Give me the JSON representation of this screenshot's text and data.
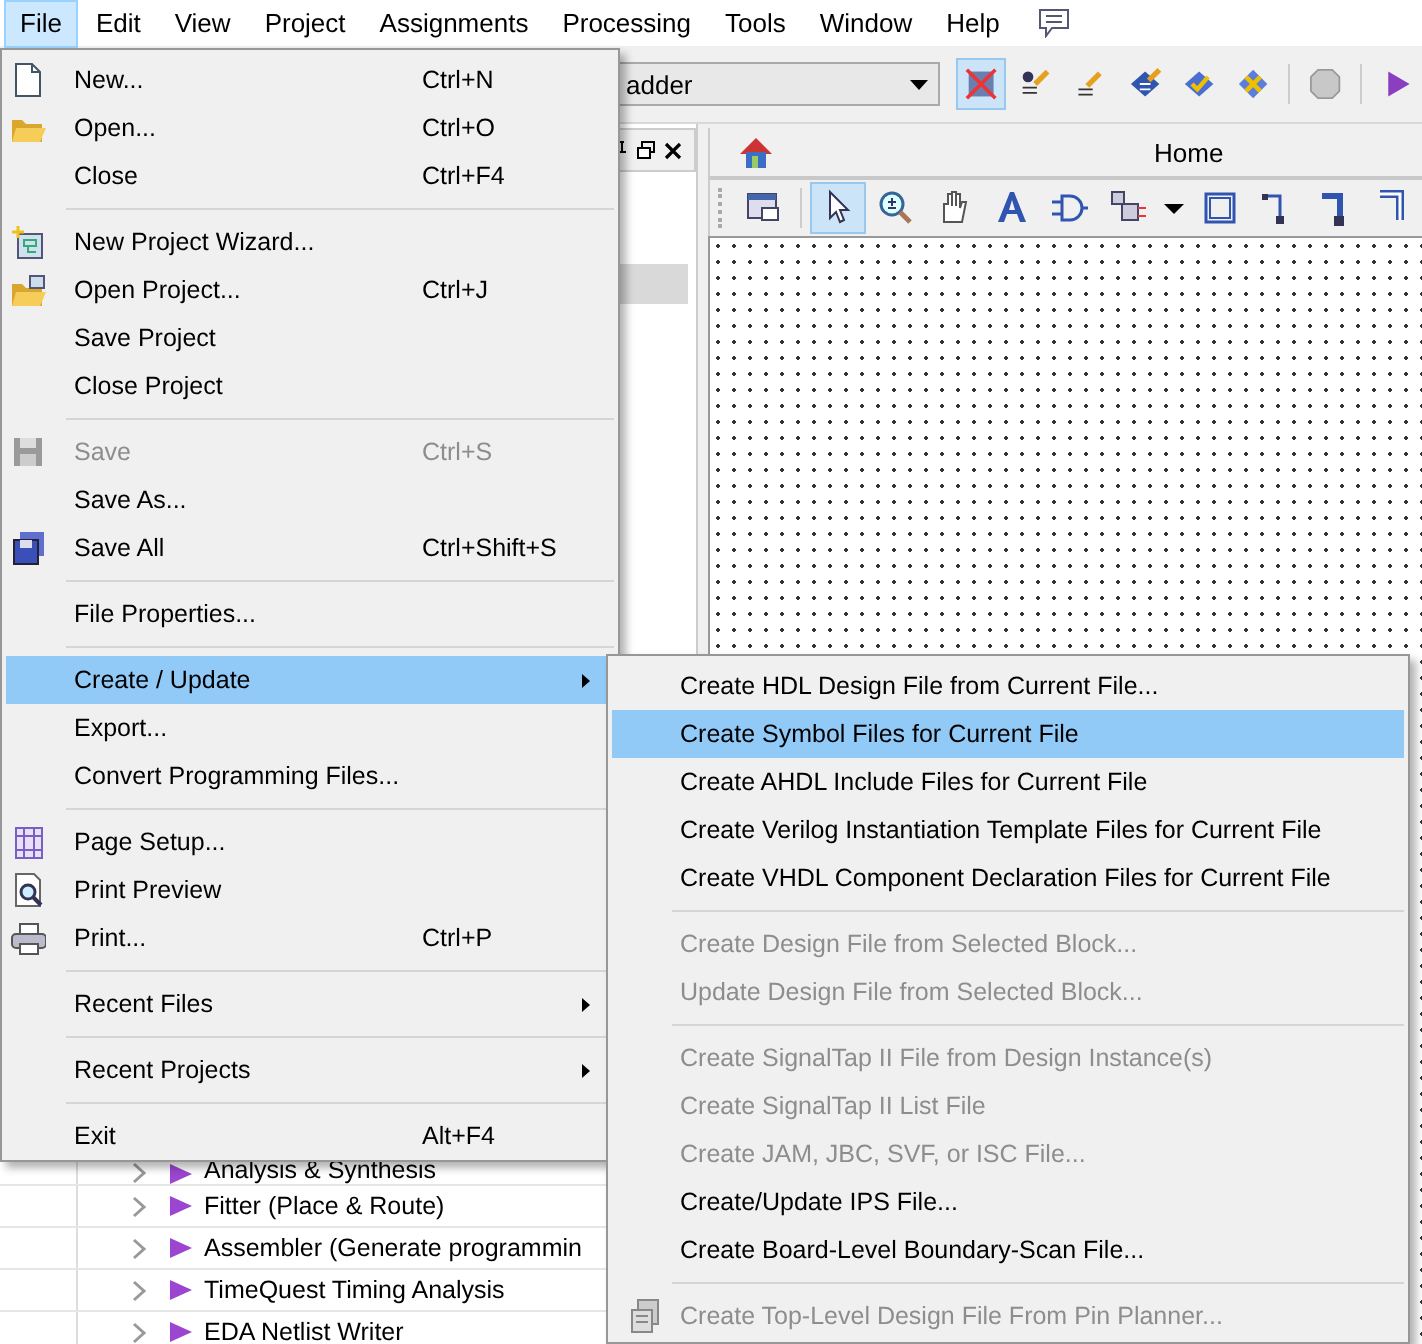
{
  "menu_bar": [
    {
      "label": "File",
      "selected": true
    },
    {
      "label": "Edit",
      "selected": false
    },
    {
      "label": "View",
      "selected": false
    },
    {
      "label": "Project",
      "selected": false
    },
    {
      "label": "Assignments",
      "selected": false
    },
    {
      "label": "Processing",
      "selected": false
    },
    {
      "label": "Tools",
      "selected": false
    },
    {
      "label": "Window",
      "selected": false
    },
    {
      "label": "Help",
      "selected": false
    }
  ],
  "toolbar": {
    "entity_dropdown": {
      "value": "adder"
    }
  },
  "home_tab": {
    "title": "Home"
  },
  "flow_tasks": [
    {
      "label": "Analysis & Synthesis"
    },
    {
      "label": "Fitter (Place & Route)"
    },
    {
      "label": "Assembler (Generate programmin"
    },
    {
      "label": "TimeQuest Timing Analysis"
    },
    {
      "label": "EDA Netlist Writer"
    }
  ],
  "file_menu": [
    {
      "kind": "item",
      "label": "New...",
      "shortcut": "Ctrl+N",
      "disabled": false,
      "selected": false,
      "submenu": false
    },
    {
      "kind": "item",
      "label": "Open...",
      "shortcut": "Ctrl+O",
      "disabled": false,
      "selected": false,
      "submenu": false
    },
    {
      "kind": "item",
      "label": "Close",
      "shortcut": "Ctrl+F4",
      "disabled": false,
      "selected": false,
      "submenu": false
    },
    {
      "kind": "separator"
    },
    {
      "kind": "item",
      "label": "New Project Wizard...",
      "disabled": false,
      "selected": false,
      "submenu": false
    },
    {
      "kind": "item",
      "label": "Open Project...",
      "shortcut": "Ctrl+J",
      "disabled": false,
      "selected": false,
      "submenu": false
    },
    {
      "kind": "item",
      "label": "Save Project",
      "disabled": false,
      "selected": false,
      "submenu": false
    },
    {
      "kind": "item",
      "label": "Close Project",
      "disabled": false,
      "selected": false,
      "submenu": false
    },
    {
      "kind": "separator"
    },
    {
      "kind": "item",
      "label": "Save",
      "shortcut": "Ctrl+S",
      "disabled": true,
      "selected": false,
      "submenu": false
    },
    {
      "kind": "item",
      "label": "Save As...",
      "disabled": false,
      "selected": false,
      "submenu": false
    },
    {
      "kind": "item",
      "label": "Save All",
      "shortcut": "Ctrl+Shift+S",
      "disabled": false,
      "selected": false,
      "submenu": false
    },
    {
      "kind": "separator"
    },
    {
      "kind": "item",
      "label": "File Properties...",
      "disabled": false,
      "selected": false,
      "submenu": false
    },
    {
      "kind": "separator"
    },
    {
      "kind": "item",
      "label": "Create / Update",
      "disabled": false,
      "selected": true,
      "submenu": true
    },
    {
      "kind": "item",
      "label": "Export...",
      "disabled": false,
      "selected": false,
      "submenu": false
    },
    {
      "kind": "item",
      "label": "Convert Programming Files...",
      "disabled": false,
      "selected": false,
      "submenu": false
    },
    {
      "kind": "separator"
    },
    {
      "kind": "item",
      "label": "Page Setup...",
      "disabled": false,
      "selected": false,
      "submenu": false
    },
    {
      "kind": "item",
      "label": "Print Preview",
      "disabled": false,
      "selected": false,
      "submenu": false
    },
    {
      "kind": "item",
      "label": "Print...",
      "shortcut": "Ctrl+P",
      "disabled": false,
      "selected": false,
      "submenu": false
    },
    {
      "kind": "separator"
    },
    {
      "kind": "item",
      "label": "Recent Files",
      "disabled": false,
      "selected": false,
      "submenu": true
    },
    {
      "kind": "separator"
    },
    {
      "kind": "item",
      "label": "Recent Projects",
      "disabled": false,
      "selected": false,
      "submenu": true
    },
    {
      "kind": "separator"
    },
    {
      "kind": "item",
      "label": "Exit",
      "shortcut": "Alt+F4",
      "disabled": false,
      "selected": false,
      "submenu": false
    }
  ],
  "create_update_submenu": [
    {
      "kind": "item",
      "label": "Create HDL Design File from Current File...",
      "disabled": false,
      "selected": false
    },
    {
      "kind": "item",
      "label": "Create Symbol Files for Current File",
      "disabled": false,
      "selected": true
    },
    {
      "kind": "item",
      "label": "Create AHDL Include Files for Current File",
      "disabled": false,
      "selected": false
    },
    {
      "kind": "item",
      "label": "Create Verilog Instantiation Template Files for Current File",
      "disabled": false,
      "selected": false
    },
    {
      "kind": "item",
      "label": "Create VHDL Component Declaration Files for Current File",
      "disabled": false,
      "selected": false
    },
    {
      "kind": "separator"
    },
    {
      "kind": "item",
      "label": "Create Design File from Selected Block...",
      "disabled": true,
      "selected": false
    },
    {
      "kind": "item",
      "label": "Update Design File from Selected Block...",
      "disabled": true,
      "selected": false
    },
    {
      "kind": "separator"
    },
    {
      "kind": "item",
      "label": "Create SignalTap II File from Design Instance(s)",
      "disabled": true,
      "selected": false
    },
    {
      "kind": "item",
      "label": "Create SignalTap II List File",
      "disabled": true,
      "selected": false
    },
    {
      "kind": "item",
      "label": "Create JAM, JBC, SVF, or ISC File...",
      "disabled": true,
      "selected": false
    },
    {
      "kind": "item",
      "label": "Create/Update IPS File...",
      "disabled": false,
      "selected": false
    },
    {
      "kind": "item",
      "label": "Create Board-Level Boundary-Scan File...",
      "disabled": false,
      "selected": false
    },
    {
      "kind": "separator"
    },
    {
      "kind": "item",
      "label": "Create Top-Level Design File From Pin Planner...",
      "disabled": true,
      "selected": false
    }
  ]
}
